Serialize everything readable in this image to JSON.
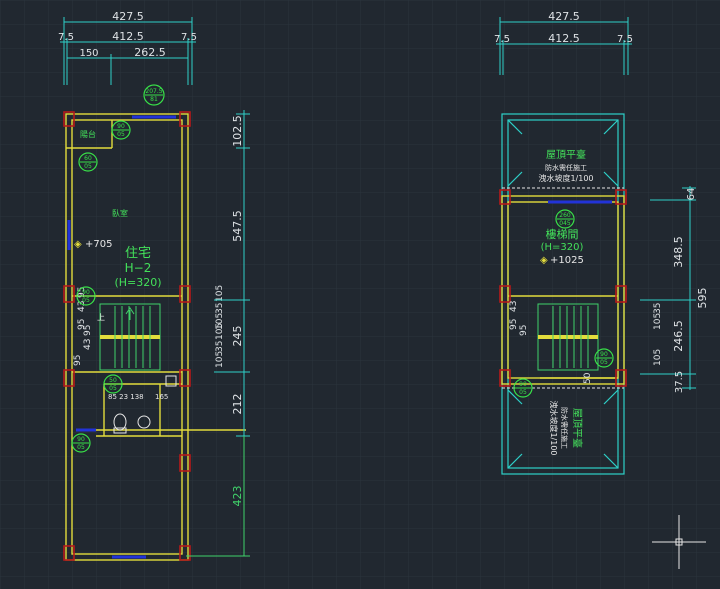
{
  "colors": {
    "background": "#212830",
    "grid": "#2b343d",
    "wall": "#e3dc3c",
    "dimension": "#2ed0c8",
    "dimension_text": "#dfe3e6",
    "dimension_far": "#40d26a",
    "text_green": "#43e05a",
    "text_white": "#e6e6e6",
    "column": "#b51a1a",
    "window": "#2233d8",
    "tag": "#38e048"
  },
  "left_plan": {
    "dim_total": "427.5",
    "dim_left_small": "7.5",
    "dim_mid": "412.5",
    "dim_right_small": "7.5",
    "dim_a": "150",
    "dim_b": "262.5",
    "right_dims": [
      "102.5",
      "547.5",
      "245",
      "212",
      "423"
    ],
    "stair_dims_left_a": [
      "95",
      "43",
      "95"
    ],
    "stair_dims_left_b": [
      "95",
      "43",
      "95"
    ],
    "stair_dims_right_a": [
      "105",
      "35",
      "105"
    ],
    "stair_dims_right_b": [
      "105",
      "35",
      "105"
    ],
    "room_title": "住宅",
    "room_code": "H−2",
    "room_height": "(H=320)",
    "level": "+705",
    "small_room_label": "臥室",
    "top_left_label": "陽台",
    "bath_dims": "85 23 138",
    "bath_dim2": "165",
    "stair_up": "上",
    "tags": [
      {
        "top": "207.5",
        "bottom": "81"
      },
      {
        "top": "90",
        "bottom": "05"
      },
      {
        "top": "60",
        "bottom": "05"
      },
      {
        "top": "90",
        "bottom": "05"
      },
      {
        "top": "50",
        "bottom": "05"
      },
      {
        "top": "90",
        "bottom": "05"
      }
    ]
  },
  "right_plan": {
    "dim_total": "427.5",
    "dim_left_small": "7.5",
    "dim_mid": "412.5",
    "dim_right_small": "7.5",
    "right_dims": [
      "64",
      "348.5",
      "246.5",
      "37.5"
    ],
    "outer_dim": "595",
    "roof_top_title": "屋頂平臺",
    "roof_top_note1": "防水需任施工",
    "roof_top_note2": "洩水坡度1/100",
    "stair_room_title": "樓梯間",
    "stair_room_height": "(H=320)",
    "level": "+1025",
    "roof_bottom_title": "屋頂平臺",
    "roof_bottom_note1": "防水需任施工",
    "roof_bottom_note2": "洩水坡度1/100",
    "stair_dims_left": [
      "95",
      "43",
      "95"
    ],
    "stair_dims_right": [
      "105",
      "35",
      "105"
    ],
    "dim_50": "50",
    "tags": [
      {
        "top": "260",
        "bottom": "045"
      },
      {
        "top": "90",
        "bottom": "05"
      },
      {
        "top": "90",
        "bottom": "05"
      }
    ]
  }
}
